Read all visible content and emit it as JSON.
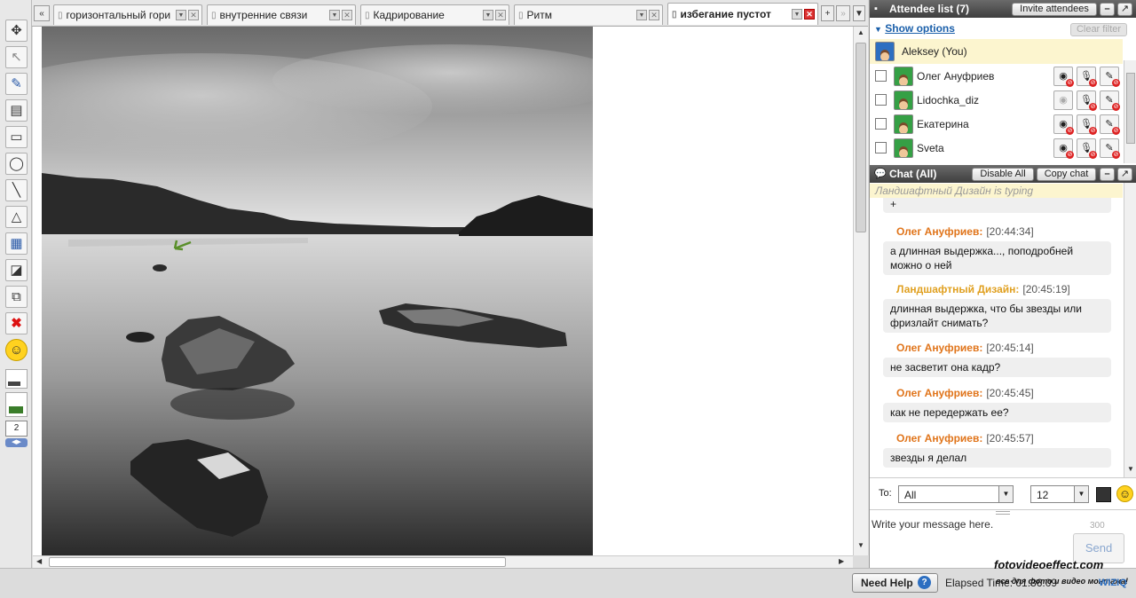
{
  "tabs": [
    {
      "label": "горизонтальный гори",
      "active": false
    },
    {
      "label": "внутренние связи",
      "active": false
    },
    {
      "label": "Кадрирование",
      "active": false
    },
    {
      "label": "Ритм",
      "active": false
    },
    {
      "label": "избегание пустот",
      "active": true
    }
  ],
  "toolbar": {
    "line_width": "2",
    "tools": [
      "move-tool-icon",
      "pointer-tool-icon",
      "pencil-tool-icon",
      "text-tool-icon",
      "rectangle-tool-icon",
      "ellipse-tool-icon",
      "line-tool-icon",
      "triangle-tool-icon",
      "table-tool-icon",
      "eraser-tool-icon",
      "layers-tool-icon",
      "delete-tool-icon",
      "smiley-tool-icon"
    ]
  },
  "attendees": {
    "title": "Attendee list (7)",
    "invite_label": "Invite attendees",
    "show_options_label": "Show options",
    "clear_filter_label": "Clear filter",
    "self": "Aleksey (You)",
    "list": [
      {
        "name": "Олег Ануфриев"
      },
      {
        "name": "Lidochka_diz"
      },
      {
        "name": "Екатерина"
      },
      {
        "name": "Sveta"
      }
    ]
  },
  "chat": {
    "title": "Chat (All)",
    "disable_all_label": "Disable All",
    "copy_chat_label": "Copy chat",
    "typing_status": "Ландшафтный Дизайн is typing",
    "first_message": "+",
    "messages": [
      {
        "from": "Олег Ануфриев:",
        "time": "[20:44:34]",
        "text": "а длинная выдержка..., поподробней можно о ней"
      },
      {
        "from": "Ландшафтный Дизайн:",
        "time": "[20:45:19]",
        "text": "длинная выдержка, что бы звезды или фризлайт снимать?"
      },
      {
        "from": "Олег Ануфриев:",
        "time": "[20:45:14]",
        "text": "не засветит она кадр?"
      },
      {
        "from": "Олег Ануфриев:",
        "time": "[20:45:45]",
        "text": "как не передержать ее?"
      },
      {
        "from": "Олег Ануфриев:",
        "time": "[20:45:57]",
        "text": "звезды я делал"
      }
    ],
    "to_label": "To:",
    "to_value": "All",
    "font_size": "12",
    "input_placeholder": "Write your message here.",
    "char_limit": "300",
    "send_label": "Send"
  },
  "footer": {
    "need_help_label": "Need Help",
    "elapsed_label": "Elapsed Time: 01:36:09",
    "watermark_line1": "fotovideoeffect.com",
    "watermark_line2": "все для фото и видео монтажа!",
    "brand": "WIZIQ"
  },
  "colors": {
    "accent_orange": "#e0741a",
    "link_blue": "#1a5faa",
    "header_dark": "#4a4a4a"
  }
}
